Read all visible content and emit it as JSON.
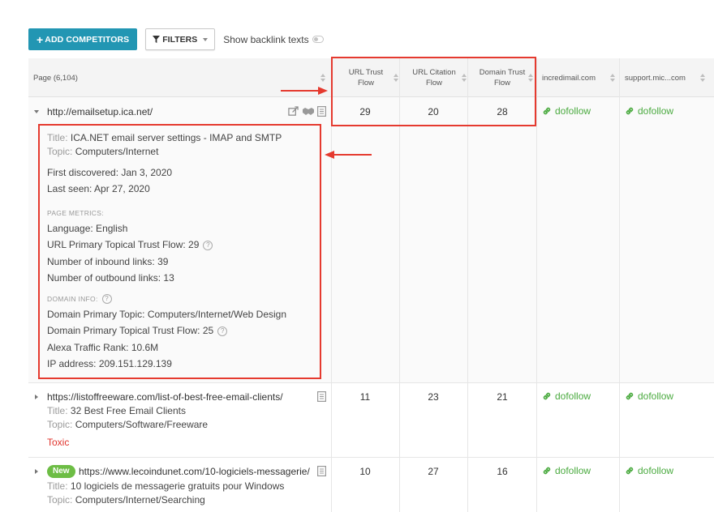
{
  "toolbar": {
    "add_competitors": "ADD COMPETITORS",
    "filters": "FILTERS",
    "show_backlink_texts": "Show backlink texts"
  },
  "header": {
    "page": "Page (6,104)",
    "url_trust_flow": "URL Trust Flow",
    "url_citation_flow": "URL Citation Flow",
    "domain_trust_flow": "Domain Trust Flow",
    "competitor_1": "incredimail.com",
    "competitor_2": "support.mic...com"
  },
  "rows": [
    {
      "url": "http://emailsetup.ica.net/",
      "url_trust_flow": "29",
      "url_citation_flow": "20",
      "domain_trust_flow": "28",
      "competitor_1": "dofollow",
      "competitor_2": "dofollow",
      "details": {
        "title_key": "Title:",
        "title": "ICA.NET email server settings - IMAP and SMTP",
        "topic_key": "Topic:",
        "topic": "Computers/Internet",
        "first_discovered": "First discovered: Jan 3, 2020",
        "last_seen": "Last seen: Apr 27, 2020",
        "page_metrics_heading": "PAGE METRICS:",
        "language": "Language: English",
        "primary_topical_tf": "URL Primary Topical Trust Flow: 29",
        "inbound_links": "Number of inbound links: 39",
        "outbound_links": "Number of outbound links: 13",
        "domain_info_heading": "DOMAIN INFO:",
        "domain_primary_topic": "Domain Primary Topic: Computers/Internet/Web Design",
        "domain_primary_topical_tf": "Domain Primary Topical Trust Flow: 25",
        "alexa_rank": "Alexa Traffic Rank: 10.6M",
        "ip_address": "IP address: 209.151.129.139"
      }
    },
    {
      "url": "https://listoffreeware.com/list-of-best-free-email-clients/",
      "title_key": "Title:",
      "title": "32 Best Free Email Clients",
      "topic_key": "Topic:",
      "topic": "Computers/Software/Freeware",
      "flag": "Toxic",
      "url_trust_flow": "11",
      "url_citation_flow": "23",
      "domain_trust_flow": "21",
      "competitor_1": "dofollow",
      "competitor_2": "dofollow"
    },
    {
      "badge": "New",
      "url": "https://www.lecoindunet.com/10-logiciels-messagerie/",
      "title_key": "Title:",
      "title": "10 logiciels de messagerie gratuits pour Windows",
      "topic_key": "Topic:",
      "topic": "Computers/Internet/Searching",
      "url_trust_flow": "10",
      "url_citation_flow": "27",
      "domain_trust_flow": "16",
      "competitor_1": "dofollow",
      "competitor_2": "dofollow"
    }
  ],
  "help_icon_glyph": "?",
  "colors": {
    "accent": "#2296b3",
    "dofollow": "#4aaa3f",
    "toxic": "#e0322b",
    "badge": "#6dbd45",
    "annotation": "#e53a2f"
  }
}
